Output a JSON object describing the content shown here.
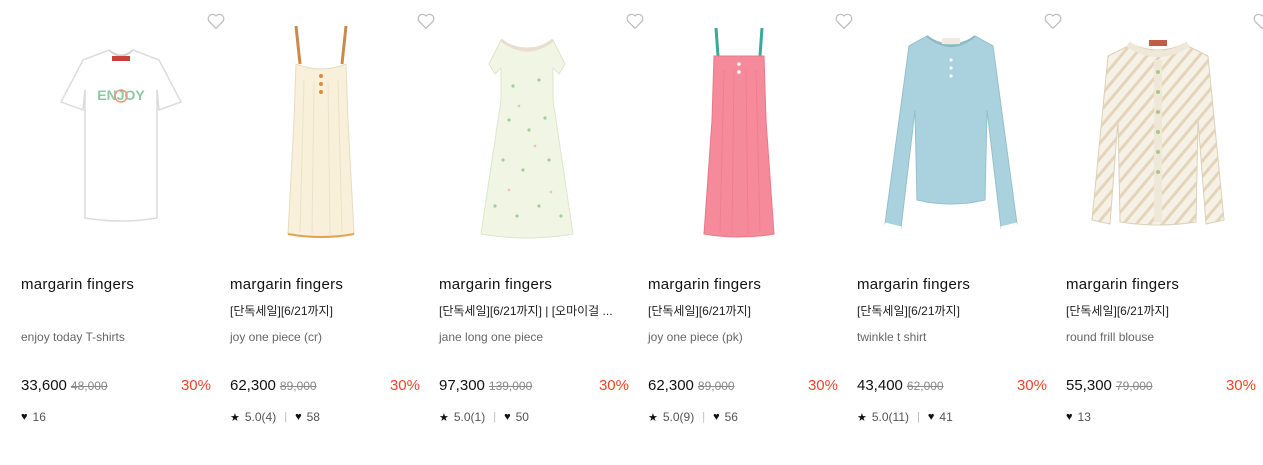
{
  "products": [
    {
      "brand": "margarin fingers",
      "tag": "",
      "name": "enjoy today T-shirts",
      "price": "33,600",
      "original_price": "48,000",
      "discount": "30%",
      "rating": "",
      "likes": "16",
      "image": "white-tshirt"
    },
    {
      "brand": "margarin fingers",
      "tag": "[단독세일][6/21까지]",
      "name": "joy one piece (cr)",
      "price": "62,300",
      "original_price": "89,000",
      "discount": "30%",
      "rating": "5.0(4)",
      "likes": "58",
      "image": "cream-slip-dress"
    },
    {
      "brand": "margarin fingers",
      "tag": "[단독세일][6/21까지] | [오마이걸 ...",
      "name": "jane long one piece",
      "price": "97,300",
      "original_price": "139,000",
      "discount": "30%",
      "rating": "5.0(1)",
      "likes": "50",
      "image": "floral-long-dress"
    },
    {
      "brand": "margarin fingers",
      "tag": "[단독세일][6/21까지]",
      "name": "joy one piece (pk)",
      "price": "62,300",
      "original_price": "89,000",
      "discount": "30%",
      "rating": "5.0(9)",
      "likes": "56",
      "image": "pink-slip-dress"
    },
    {
      "brand": "margarin fingers",
      "tag": "[단독세일][6/21까지]",
      "name": "twinkle t shirt",
      "price": "43,400",
      "original_price": "62,000",
      "discount": "30%",
      "rating": "5.0(11)",
      "likes": "41",
      "image": "blue-long-sleeve-top"
    },
    {
      "brand": "margarin fingers",
      "tag": "[단독세일][6/21까지]",
      "name": "round frill blouse",
      "price": "55,300",
      "original_price": "79,000",
      "discount": "30%",
      "rating": "",
      "likes": "13",
      "image": "striped-frill-blouse"
    }
  ],
  "icons": {
    "wishlist": "heart-outline-icon",
    "rating": "star-icon",
    "likes": "heart-filled-icon"
  },
  "colors": {
    "discount": "#e8452b",
    "text": "#111111",
    "muted": "#888888"
  }
}
